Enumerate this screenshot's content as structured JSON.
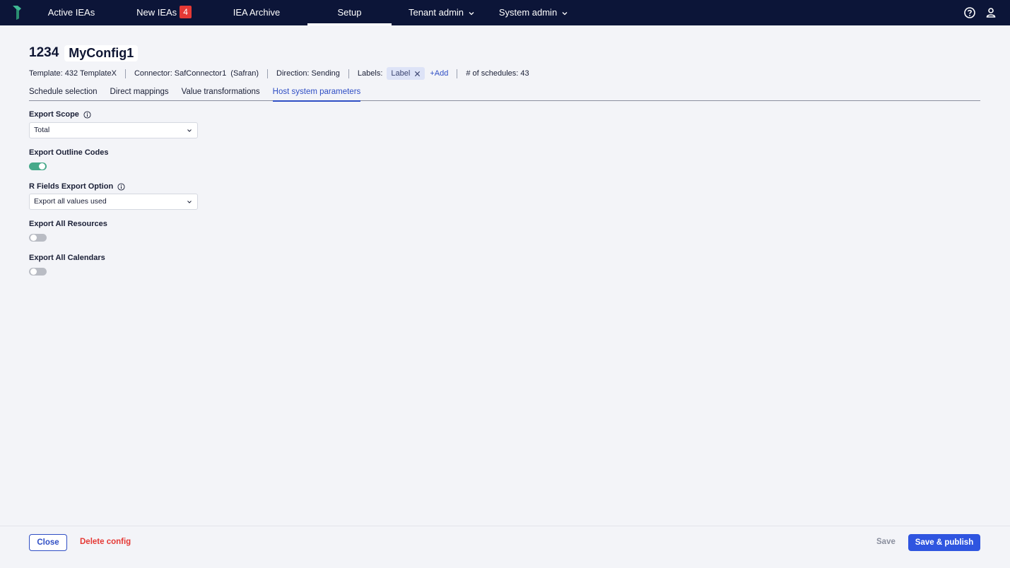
{
  "nav": {
    "items": [
      {
        "label": "Active IEAs"
      },
      {
        "label": "New IEAs",
        "badge": "4"
      },
      {
        "label": "IEA Archive"
      },
      {
        "label": "Setup",
        "active": true
      },
      {
        "label": "Tenant admin"
      },
      {
        "label": "System admin"
      }
    ],
    "icons": [
      "help-icon",
      "user-icon"
    ],
    "bg_color": "#0c1538"
  },
  "config": {
    "id": "1234",
    "name": "MyConfig1"
  },
  "meta": {
    "template": "Template: 432 TemplateX",
    "connector": "Connector: SafConnector1  (Safran)",
    "direction": "Direction: Sending",
    "labels_title": "Labels:",
    "label_chip": "Label",
    "add_label": "+Add",
    "schedules": "# of schedules: 43"
  },
  "tabs": [
    {
      "label": "Schedule selection"
    },
    {
      "label": "Direct mappings"
    },
    {
      "label": "Value transformations"
    },
    {
      "label": "Host system parameters",
      "active": true
    }
  ],
  "form": {
    "export_scope": {
      "label": "Export Scope",
      "value": "Total"
    },
    "export_outline_codes": {
      "label": "Export Outline Codes",
      "enabled": true
    },
    "r_fields_export_option": {
      "label": "R Fields Export Option",
      "value": "Export all values used"
    },
    "export_all_resources": {
      "label": "Export All Resources",
      "enabled": false
    },
    "export_all_calendars": {
      "label": "Export All Calendars",
      "enabled": false
    }
  },
  "footer": {
    "close": "Close",
    "delete": "Delete config",
    "save": "Save",
    "save_publish": "Save & publish"
  },
  "colors": {
    "accent": "#2f4ec4",
    "danger": "#e53935",
    "toggle_on": "#46a98a"
  }
}
